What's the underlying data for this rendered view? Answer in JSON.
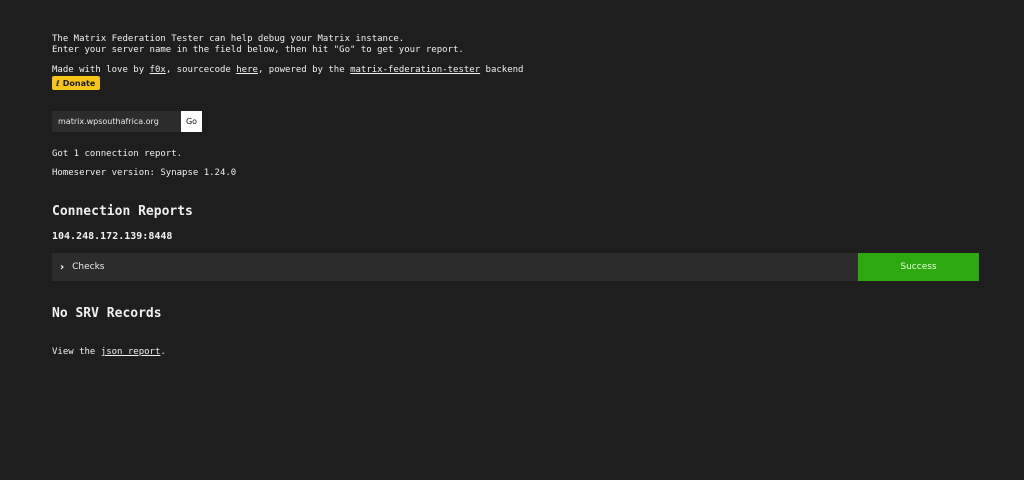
{
  "intro": {
    "line1": "The Matrix Federation Tester can help debug your Matrix instance.",
    "line2": "Enter your server name in the field below, then hit \"Go\" to get your report."
  },
  "credits": {
    "prefix": "Made with love by ",
    "author_link": "f0x",
    "middle": ", sourcecode ",
    "source_link": "here",
    "middle2": ", powered by the ",
    "backend_link": "matrix-federation-tester",
    "suffix": " backend"
  },
  "donate": {
    "label": "Donate",
    "icon": "liberapay-icon"
  },
  "search": {
    "value": "matrix.wpsouthafrica.org",
    "button_label": "Go"
  },
  "summary": {
    "reports": "Got 1 connection report.",
    "version": "Homeserver version: Synapse 1.24.0"
  },
  "connection_reports": {
    "heading": "Connection Reports",
    "address": "104.248.172.139:8448",
    "checks_label": "Checks",
    "status": "Success"
  },
  "srv": {
    "heading": "No SRV Records"
  },
  "json_report": {
    "prefix": "View the ",
    "link": "json report",
    "suffix": "."
  },
  "colors": {
    "background": "#1e1e1e",
    "success": "#2ea80f",
    "donate": "#f5c518"
  }
}
